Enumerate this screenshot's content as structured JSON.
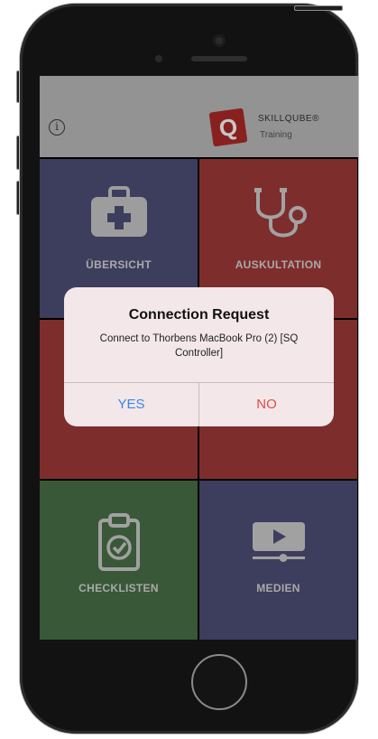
{
  "header": {
    "info_icon": "info-icon",
    "brand_mark": "Q",
    "brand_name": "SKILLQUBE®",
    "brand_sub": "Training"
  },
  "tiles": [
    {
      "label": "ÜBERSICHT",
      "icon": "first-aid-kit-icon",
      "color": "#4f4f78"
    },
    {
      "label": "AUSKULTATION",
      "icon": "stethoscope-icon",
      "color": "#a23a3a"
    },
    {
      "label": "",
      "icon": "",
      "color": "#a23a3a"
    },
    {
      "label": "",
      "icon": "",
      "color": "#a23a3a"
    },
    {
      "label": "CHECKLISTEN",
      "icon": "clipboard-check-icon",
      "color": "#497148"
    },
    {
      "label": "MEDIEN",
      "icon": "video-player-icon",
      "color": "#4f4f78"
    }
  ],
  "alert": {
    "title": "Connection Request",
    "message": "Connect to Thorbens MacBook Pro (2) [SQ Controller]",
    "yes_label": "YES",
    "no_label": "NO",
    "yes_color": "#3a86e8",
    "no_color": "#e34a45"
  }
}
